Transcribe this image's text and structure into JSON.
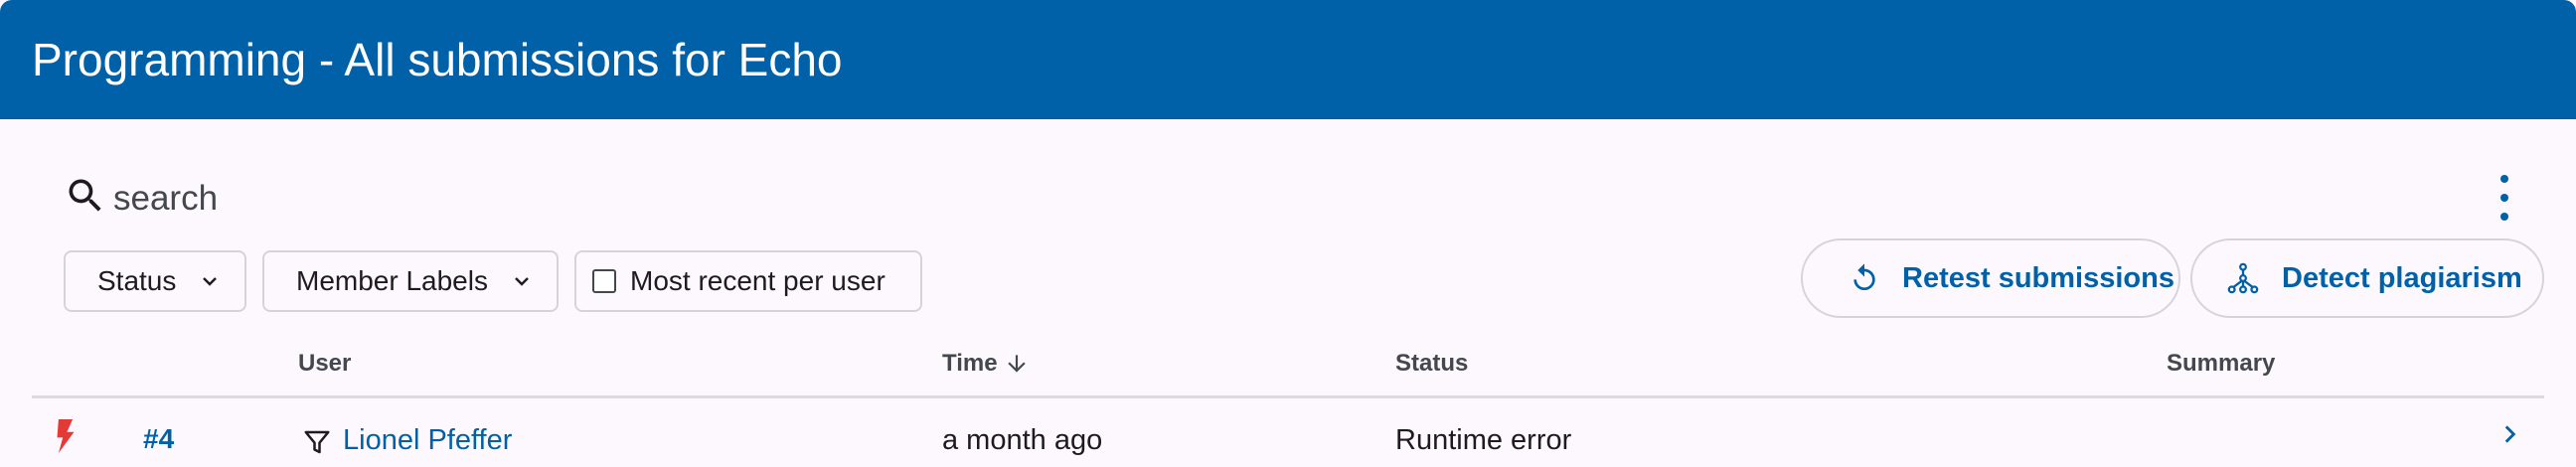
{
  "header": {
    "title": "Programming - All submissions for Echo"
  },
  "search": {
    "placeholder": "search",
    "value": ""
  },
  "filters": {
    "status_label": "Status",
    "member_labels_label": "Member Labels",
    "most_recent_label": "Most recent per user",
    "most_recent_checked": false
  },
  "actions": {
    "retest_label": "Retest submissions",
    "plagiarism_label": "Detect plagiarism"
  },
  "table": {
    "columns": {
      "user": "User",
      "time": "Time",
      "status": "Status",
      "summary": "Summary"
    },
    "sort": {
      "column": "time",
      "direction": "descending"
    },
    "rows": [
      {
        "id": "#4",
        "user": "Lionel Pfeffer",
        "time": "a month ago",
        "status": "Runtime error",
        "summary": "",
        "status_icon": "bolt-icon"
      }
    ]
  },
  "colors": {
    "primary": "#0061a8",
    "error": "#e53935",
    "background": "#fcf8fd"
  }
}
